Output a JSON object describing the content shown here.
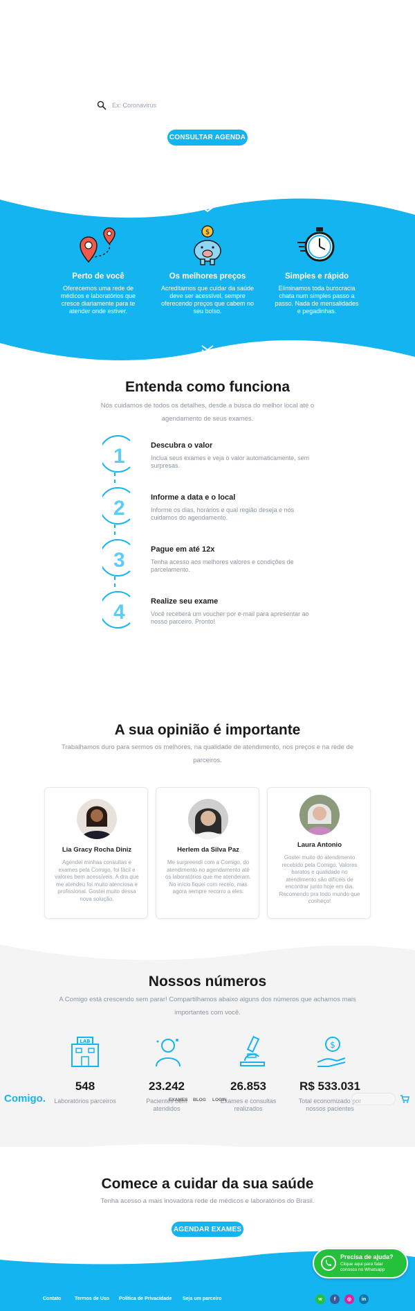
{
  "search": {
    "placeholder": "Ex: Coronavirus"
  },
  "hero": {
    "cta_label": "CONSULTAR AGENDA"
  },
  "features": [
    {
      "title": "Perto de você",
      "text": "Oferecemos uma rede de médicos e laboratórios que cresce diariamente para te atender onde estiver."
    },
    {
      "title": "Os melhores preços",
      "text": "Acreditamos que cuidar da saúde deve ser acessível, sempre oferecendo preços que cabem no seu bolso."
    },
    {
      "title": "Simples e rápido",
      "text": "Eliminamos toda burocracia chata num simples passo a passo. Nada de mensalidades e pegadinhas."
    }
  ],
  "how": {
    "title": "Entenda como funciona",
    "subtitle_line1": "Nós cuidamos de todos os detalhes, desde a busca do melhor local até o",
    "subtitle_line2": "agendamento de seus exames.",
    "steps": [
      {
        "number": "1",
        "title": "Descubra o valor",
        "text": "Inclua seus exames e veja o valor automaticamente, sem surpresas."
      },
      {
        "number": "2",
        "title": "Informe a data e o local",
        "text": "Informe os dias, horários e qual região deseja e nós cuidamos do agendamento."
      },
      {
        "number": "3",
        "title": "Pague em até 12x",
        "text": "Tenha acesso aos melhores valores e condições de parcelamento."
      },
      {
        "number": "4",
        "title": "Realize seu exame",
        "text": "Você receberá um voucher por e-mail para apresentar ao nosso parceiro. Pronto!"
      }
    ]
  },
  "opinion": {
    "title": "A sua opinião é importante",
    "subtitle_line1": "Trabalhamos duro para sermos os melhores, na qualidade de atendimento, nos preços e na rede de",
    "subtitle_line2": "parceiros.",
    "testimonials": [
      {
        "name": "Lia Gracy Rocha Diniz",
        "text": "Agendei minhas consultas e exames pela Comigo, foi fácil e valores bem acessíveis. A dra que me atendeu foi muito atenciosa e profissional. Gostei muito dessa nova solução."
      },
      {
        "name": "Herlem da Silva Paz",
        "text": "Me surpreendi com a Comigo, do atendimento no agendamento até os laboratórios que me atenderam. No início fiquei com receio, mas agora sempre recorro a eles."
      },
      {
        "name": "Laura Antonio",
        "text": "Gostei muito do atendimento recebido pela Comigo. Valores baratos e qualidade no atendimento são difíceis de encontrar junto hoje em dia. Recomendo pra todo mundo que conheço!"
      }
    ]
  },
  "numbers": {
    "title": "Nossos números",
    "subtitle_line1": "A Comigo está crescendo sem parar! Compartilhamos abaixo alguns dos números que achamos mais",
    "subtitle_line2": "importantes com você.",
    "stats": [
      {
        "value": "548",
        "label": "Laboratórios parceiros"
      },
      {
        "value": "23.242",
        "label": "Pacientes bem atendidos"
      },
      {
        "value": "26.853",
        "label": "Exames e consultas realizados"
      },
      {
        "value": "R$ 533.031",
        "label": "Total economizado por nossos pacientes"
      }
    ]
  },
  "navbar": {
    "logo": "Comigo.",
    "links": [
      "EXAMES",
      "BLOG",
      "LOGIN"
    ]
  },
  "cta": {
    "title": "Comece a cuidar da sua saúde",
    "subtitle": "Tenha acesso a mais inovadora rede de médicos e laboratórios do Brasil.",
    "button_label": "AGENDAR EXAMES"
  },
  "whatsapp": {
    "title": "Precisa de ajuda?",
    "line1": "Clique aqui para falar",
    "line2": "conosco no Whatsapp"
  },
  "footer": {
    "links": [
      "Contato",
      "Termos de Uso",
      "Política de Privacidade",
      "Seja um parceiro"
    ]
  },
  "colors": {
    "brand": "#14b4f0",
    "whatsapp": "#25c13a"
  }
}
